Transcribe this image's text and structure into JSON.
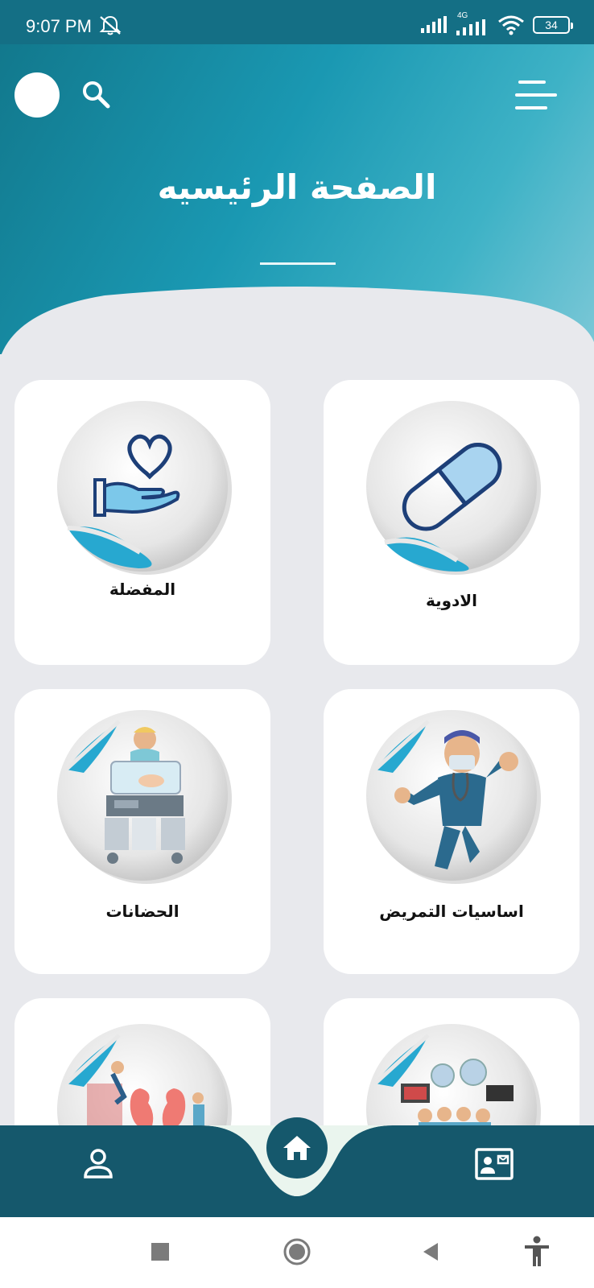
{
  "status_bar": {
    "time": "9:07 PM",
    "network": "4G",
    "battery": "34"
  },
  "header": {
    "title": "الصفحة الرئيسيه"
  },
  "cards": [
    {
      "label": "الادوية",
      "icon": "capsule-icon"
    },
    {
      "label": "المفضلة",
      "icon": "heart-hand-icon"
    },
    {
      "label": "اساسيات التمريض",
      "icon": "nurse-hero-illustration"
    },
    {
      "label": "الحضانات",
      "icon": "incubator-illustration"
    },
    {
      "label": "",
      "icon": "operating-room-illustration"
    },
    {
      "label": "",
      "icon": "kidney-dialysis-illustration"
    }
  ],
  "bottom_nav": {
    "items": [
      "profile-icon",
      "home-icon",
      "id-card-icon"
    ]
  },
  "system_nav": {
    "items": [
      "recents-icon",
      "home-circle-icon",
      "back-icon",
      "accessibility-icon"
    ]
  },
  "colors": {
    "header_dark": "#146f85",
    "header_light": "#7fc9d8",
    "nav_bar": "#15586c",
    "accent_curl": "#27a8d0",
    "icon_blue": "#1d3f78",
    "panel_bg": "#e8e9ed"
  }
}
